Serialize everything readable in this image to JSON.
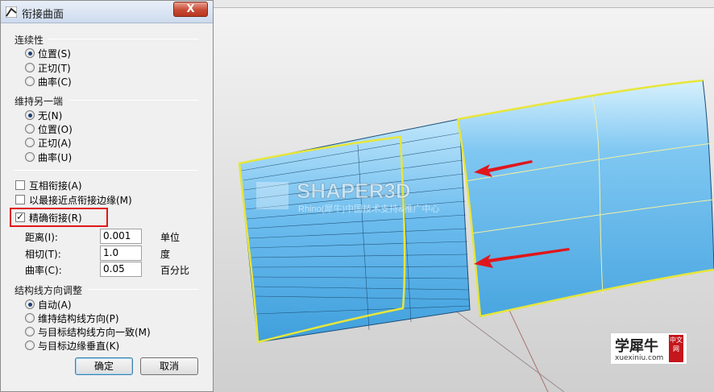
{
  "dialog": {
    "title": "衔接曲面",
    "close_label": "X",
    "continuity": {
      "title": "连续性",
      "options": [
        "位置(S)",
        "正切(T)",
        "曲率(C)"
      ],
      "selected": 0
    },
    "maintain_other_end": {
      "title": "维持另一端",
      "options": [
        "无(N)",
        "位置(O)",
        "正切(A)",
        "曲率(U)"
      ],
      "selected": 0
    },
    "checkboxes": [
      {
        "label": "互相衔接(A)",
        "checked": false
      },
      {
        "label": "以最接近点衔接边缘(M)",
        "checked": false
      },
      {
        "label": "精确衔接(R)",
        "checked": true
      }
    ],
    "tolerances": [
      {
        "label": "距离(I):",
        "value": "0.001",
        "unit": "单位"
      },
      {
        "label": "相切(T):",
        "value": "1.0",
        "unit": "度"
      },
      {
        "label": "曲率(C):",
        "value": "0.05",
        "unit": "百分比"
      }
    ],
    "isocurve": {
      "title": "结构线方向调整",
      "options": [
        "自动(A)",
        "维持结构线方向(P)",
        "与目标结构线方向一致(M)",
        "与目标边缘垂直(K)"
      ],
      "selected": 0
    },
    "ok_label": "确定",
    "cancel_label": "取消"
  },
  "viewport": {
    "watermark_title": "SHAPER3D",
    "watermark_subtitle": "Rhino(犀牛)中国技术支持&推广中心",
    "surface_color": "#66b8ec",
    "edge_color": "#e7e63a",
    "arrow_color": "#e0161b"
  },
  "badge": {
    "title": "学犀牛",
    "tag": "中文网",
    "url": "xuexiniu.com"
  }
}
